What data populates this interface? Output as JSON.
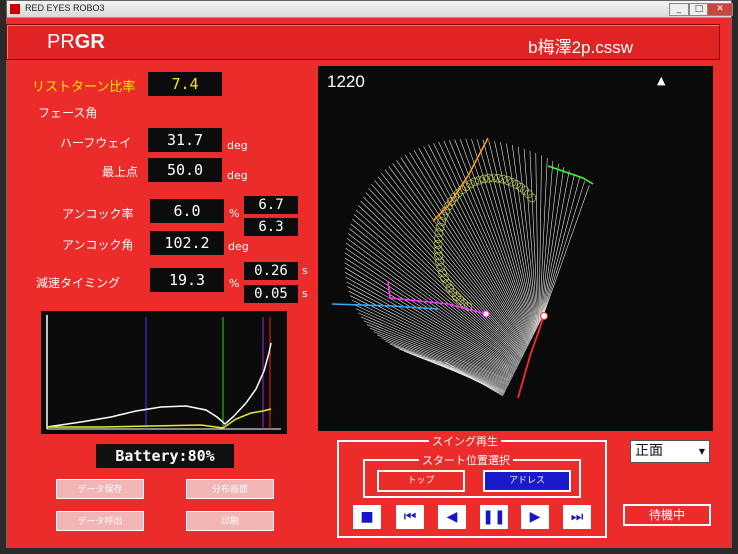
{
  "window": {
    "title": "RED EYES ROBO3",
    "minimize": "_",
    "maximize": "□",
    "close": "✕"
  },
  "header": {
    "brand_prefix": "PR",
    "brand_bold": "GR",
    "filename": "b梅澤2p.cssw"
  },
  "metrics": {
    "return_rate": {
      "label": "リストターン比率",
      "value": "7.4"
    },
    "face_angle_label": "フェース角",
    "halfway": {
      "label": "ハーフウェイ",
      "value": "31.7",
      "unit": "deg"
    },
    "top": {
      "label": "最上点",
      "value": "50.0",
      "unit": "deg"
    },
    "uncock_rate": {
      "label": "アンコック率",
      "value": "6.0",
      "unit": "%",
      "extra1": "6.7",
      "extra2": "6.3"
    },
    "uncock_angle": {
      "label": "アンコック角",
      "value": "102.2",
      "unit": "deg"
    },
    "decel": {
      "label": "減速タイミング",
      "value": "19.3",
      "unit": "%",
      "extra1": "0.26",
      "extra2": "0.05",
      "extra_unit": "s"
    }
  },
  "battery": "Battery:80%",
  "gray_buttons": {
    "data_save": "データ保存",
    "distribution": "分布画面",
    "data_load": "データ呼出",
    "print": "印刷"
  },
  "viewer": {
    "frame": "1220"
  },
  "playback": {
    "title": "スイング再生",
    "start_title": "スタート位置選択",
    "top": "トップ",
    "address": "アドレス",
    "stop": "■",
    "first": "⏮",
    "prev": "◀",
    "pause": "❚❚",
    "next": "▶",
    "last": "⏭"
  },
  "view_select": "正面",
  "status": "待機中",
  "colors": {
    "window_red": "#ec2b2b",
    "accent_yellow": "#ffe600",
    "selected_blue": "#1a1acc"
  }
}
